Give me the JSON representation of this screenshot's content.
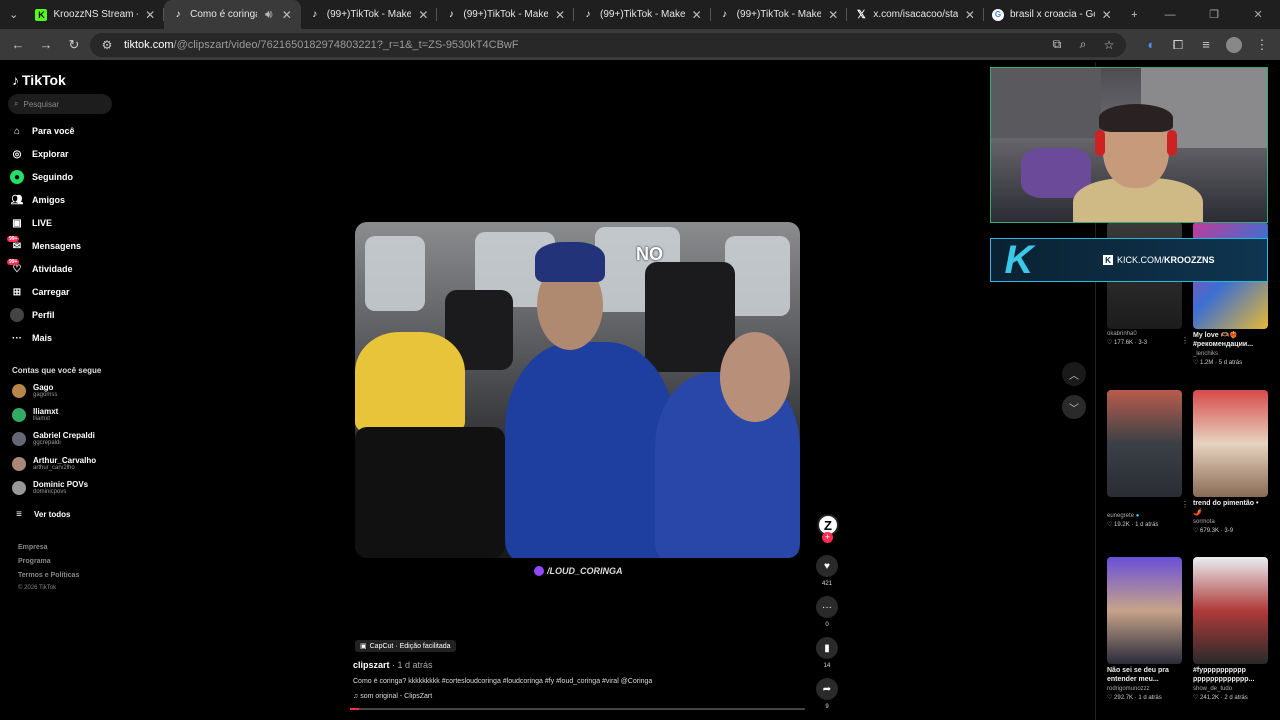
{
  "browser": {
    "tabs": [
      {
        "title": "KroozzNS Stream - Watch",
        "icon": "kick",
        "active": false
      },
      {
        "title": "Como é coringa? kkkkkkkk",
        "icon": "tiktok",
        "active": true
      },
      {
        "title": "(99+)TikTok - Make Your Day",
        "icon": "tiktok",
        "active": false
      },
      {
        "title": "(99+)TikTok - Make Your Day",
        "icon": "tiktok",
        "active": false
      },
      {
        "title": "(99+)TikTok - Make Your Day",
        "icon": "tiktok",
        "active": false
      },
      {
        "title": "(99+)TikTok - Make Your Day",
        "icon": "tiktok",
        "active": false
      },
      {
        "title": "x.com/isacacoo/status/20",
        "icon": "x",
        "active": false
      },
      {
        "title": "brasil x croacia - Google",
        "icon": "google",
        "active": false
      }
    ],
    "url_host": "tiktok.com",
    "url_path": "/@clipszart/video/7621650182974803221?_r=1&_t=ZS-9530kT4CBwF"
  },
  "sidebar": {
    "logo": "TikTok",
    "search_placeholder": "Pesquisar",
    "nav": [
      {
        "label": "Para você",
        "icon": "home-icon"
      },
      {
        "label": "Explorar",
        "icon": "compass-icon"
      },
      {
        "label": "Seguindo",
        "icon": "following-icon"
      },
      {
        "label": "Amigos",
        "icon": "friends-icon"
      },
      {
        "label": "LIVE",
        "icon": "live-icon"
      },
      {
        "label": "Mensagens",
        "icon": "messages-icon",
        "badge": "99+"
      },
      {
        "label": "Atividade",
        "icon": "activity-icon",
        "badge": "99+"
      },
      {
        "label": "Carregar",
        "icon": "upload-icon"
      },
      {
        "label": "Perfil",
        "icon": "profile-icon"
      },
      {
        "label": "Mais",
        "icon": "more-icon"
      }
    ],
    "following_header": "Contas que você segue",
    "following": [
      {
        "name": "Gago",
        "handle": "gagomss"
      },
      {
        "name": "lliamxt",
        "handle": "lliamxt"
      },
      {
        "name": "Gabriel Crepaldi",
        "handle": "ggcrepaldi"
      },
      {
        "name": "Arthur_Carvalho",
        "handle": "arthur_carv2lho"
      },
      {
        "name": "Dominic POVs",
        "handle": "dominicpovs"
      }
    ],
    "see_all": "Ver todos",
    "footer": [
      "Empresa",
      "Programa",
      "Termos e Políticas",
      "© 2026 TikTok"
    ]
  },
  "video": {
    "overlay_text": "NO",
    "watermark": "/LOUD_CORINGA",
    "capcut": "CapCut · Edição facilitada",
    "author": "clipszart",
    "posted": " · 1 d atrás",
    "description": "Como é coringa? kkkkkkkkk #cortesloudcoringa #loudcoringa #fy #loud_coringa #viral @Coringa",
    "music": "som original - ClipsZart",
    "progress": 0.02,
    "creator_initial": "Z",
    "likes": "421",
    "comments": "0",
    "saves": "14",
    "shares": "9"
  },
  "stream_overlay": {
    "kick_url_prefix": "KICK.COM/",
    "kick_url_user": "KROOZZNS"
  },
  "recommendations": [
    {
      "caption": "",
      "user": "okabrinha0",
      "verified": false,
      "views": "177.6K",
      "age": "3-3"
    },
    {
      "caption": "My love 🫶🏽❤️‍🔥 #рекомендации...",
      "user": "_lenchiks",
      "verified": false,
      "views": "1.2M",
      "age": "5 d atrás"
    },
    {
      "caption": "",
      "user": "eunegrete",
      "verified": true,
      "views": "19.2K",
      "age": "1 d atrás"
    },
    {
      "caption": "trend do pimentão • 🌶️",
      "user": "sormota",
      "verified": false,
      "views": "679.3K",
      "age": "3-9"
    },
    {
      "caption": "Não sei se deu pra entender meu...",
      "user": "rodrigomunozzz",
      "verified": false,
      "views": "292.7K",
      "age": "1 d atrás"
    },
    {
      "caption": "#fypppppppppp ppppppppppppp...",
      "user": "show_de_tudo",
      "verified": false,
      "views": "241.2K",
      "age": "2 d atrás"
    }
  ]
}
